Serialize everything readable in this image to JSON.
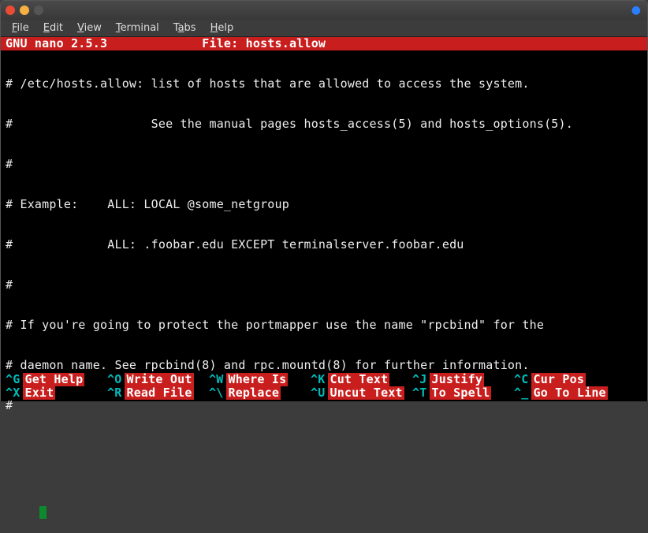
{
  "window": {
    "menus": {
      "file": "File",
      "edit": "Edit",
      "view": "View",
      "terminal": "Terminal",
      "tabs": "Tabs",
      "help": "Help"
    }
  },
  "nano": {
    "app": "GNU nano 2.5.3",
    "file_label": "File: hosts.allow"
  },
  "lines": [
    "# /etc/hosts.allow: list of hosts that are allowed to access the system.",
    "#                   See the manual pages hosts_access(5) and hosts_options(5).",
    "#",
    "# Example:    ALL: LOCAL @some_netgroup",
    "#             ALL: .foobar.edu EXCEPT terminalserver.foobar.edu",
    "#",
    "# If you're going to protect the portmapper use the name \"rpcbind\" for the",
    "# daemon name. See rpcbind(8) and rpc.mountd(8) for further information.",
    "#"
  ],
  "shortcuts": {
    "row1": [
      {
        "key": "^G",
        "label": "Get Help"
      },
      {
        "key": "^O",
        "label": "Write Out"
      },
      {
        "key": "^W",
        "label": "Where Is"
      },
      {
        "key": "^K",
        "label": "Cut Text"
      },
      {
        "key": "^J",
        "label": "Justify"
      },
      {
        "key": "^C",
        "label": "Cur Pos"
      }
    ],
    "row2": [
      {
        "key": "^X",
        "label": "Exit"
      },
      {
        "key": "^R",
        "label": "Read File"
      },
      {
        "key": "^\\",
        "label": "Replace"
      },
      {
        "key": "^U",
        "label": "Uncut Text"
      },
      {
        "key": "^T",
        "label": "To Spell"
      },
      {
        "key": "^_",
        "label": "Go To Line"
      }
    ]
  }
}
